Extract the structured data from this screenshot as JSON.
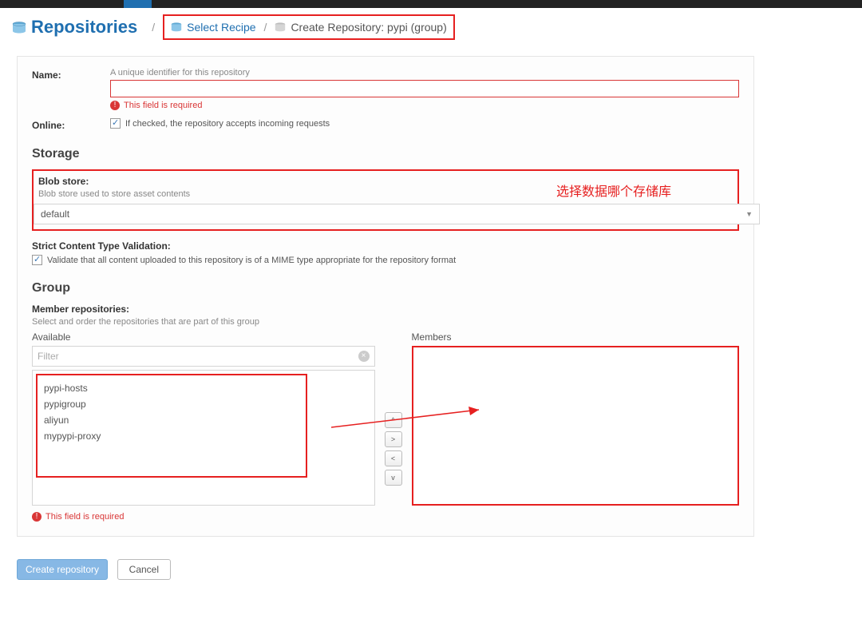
{
  "breadcrumb": {
    "root": "Repositories",
    "step1": "Select Recipe",
    "step2": "Create Repository: pypi (group)"
  },
  "fields": {
    "name": {
      "label": "Name:",
      "help": "A unique identifier for this repository",
      "error": "This field is required"
    },
    "online": {
      "label": "Online:",
      "check_label": "If checked, the repository accepts incoming requests",
      "checked": true
    }
  },
  "storage": {
    "section": "Storage",
    "blob_label": "Blob store:",
    "blob_help": "Blob store used to store asset contents",
    "blob_value": "default",
    "annotation": "选择数据哪个存储库",
    "strict_label": "Strict Content Type Validation:",
    "strict_check": "Validate that all content uploaded to this repository is of a MIME type appropriate for the repository format",
    "strict_checked": true
  },
  "group": {
    "section": "Group",
    "member_label": "Member repositories:",
    "member_help": "Select and order the repositories that are part of this group",
    "available_label": "Available",
    "members_label": "Members",
    "filter_placeholder": "Filter",
    "available_items": [
      "pypi-hosts",
      "pypigroup",
      "aliyun",
      "mypypi-proxy"
    ],
    "error": "This field is required"
  },
  "footer": {
    "create": "Create repository",
    "cancel": "Cancel"
  }
}
